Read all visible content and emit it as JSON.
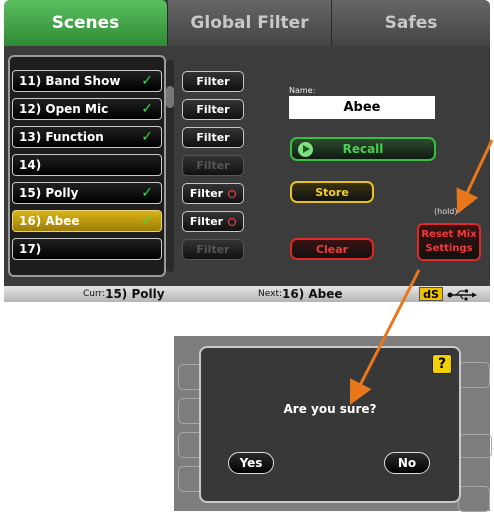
{
  "tabs": [
    "Scenes",
    "Global Filter",
    "Safes"
  ],
  "scenes": [
    {
      "label": "11) Band Show",
      "stored": true,
      "selected": false,
      "filter": "Filter",
      "filter_enabled": true,
      "filter_active": false
    },
    {
      "label": "12) Open Mic",
      "stored": true,
      "selected": false,
      "filter": "Filter",
      "filter_enabled": true,
      "filter_active": false
    },
    {
      "label": "13) Function",
      "stored": true,
      "selected": false,
      "filter": "Filter",
      "filter_enabled": true,
      "filter_active": false
    },
    {
      "label": "14)",
      "stored": false,
      "selected": false,
      "filter": "Filter",
      "filter_enabled": false,
      "filter_active": false
    },
    {
      "label": "15) Polly",
      "stored": true,
      "selected": false,
      "filter": "Filter",
      "filter_enabled": true,
      "filter_active": true
    },
    {
      "label": "16) Abee",
      "stored": true,
      "selected": true,
      "filter": "Filter",
      "filter_enabled": true,
      "filter_active": true
    },
    {
      "label": "17)",
      "stored": false,
      "selected": false,
      "filter": "Filter",
      "filter_enabled": false,
      "filter_active": false
    }
  ],
  "checkmark": "✓",
  "name_label": "Name:",
  "name_value": "Abee",
  "recall_label": "Recall",
  "store_label": "Store",
  "clear_label": "Clear",
  "hold_label": "(hold)",
  "reset_label_line1": "Reset Mix",
  "reset_label_line2": "Settings",
  "status": {
    "curr_prefix": "Curr:",
    "curr_value": "15) Polly",
    "next_prefix": "Next:",
    "next_value": "16) Abee",
    "badge": "dS"
  },
  "dialog": {
    "help": "?",
    "question": "Are you sure?",
    "yes": "Yes",
    "no": "No"
  },
  "colors": {
    "active_tab": "#3aa040",
    "selected_row": "#c9a311",
    "checkmark": "#35e04a",
    "annotation_arrow": "#e8771a",
    "recall": "#35c040",
    "store": "#e8c020",
    "clear_reset": "#e02828"
  }
}
